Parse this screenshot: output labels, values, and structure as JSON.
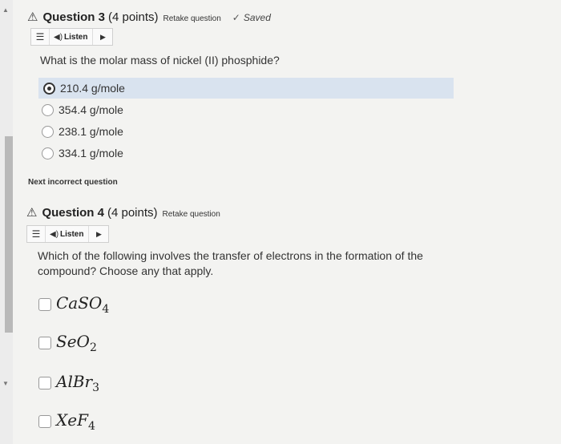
{
  "q3": {
    "warn_icon": "⚠",
    "title": "Question 3",
    "points": "(4 points)",
    "retake": "Retake question",
    "saved": "Saved",
    "listen": "Listen",
    "prompt": "What is the molar mass of nickel (II) phosphide?",
    "options": [
      "210.4 g/mole",
      "354.4 g/mole",
      "238.1 g/mole",
      "334.1 g/mole"
    ],
    "selected_index": 0
  },
  "next_incorrect": "Next incorrect question",
  "q4": {
    "warn_icon": "⚠",
    "title": "Question 4",
    "points": "(4 points)",
    "retake": "Retake question",
    "listen": "Listen",
    "prompt_line1": "Which of the following involves the transfer of electrons in the formation of the",
    "prompt_line2": "compound? Choose any that apply.",
    "options": [
      {
        "main": "CaSO",
        "sub": "4"
      },
      {
        "main": "SeO",
        "sub": "2"
      },
      {
        "main": "AlBr",
        "sub": "3"
      },
      {
        "main": "XeF",
        "sub": "4"
      }
    ]
  },
  "icons": {
    "warning": "warning-triangle-icon",
    "menu": "menu-icon",
    "speaker": "speaker-icon",
    "play": "play-icon",
    "check": "check-icon"
  },
  "colors": {
    "selected_row": "#d9e3ef",
    "page_bg": "#f3f3f1"
  }
}
